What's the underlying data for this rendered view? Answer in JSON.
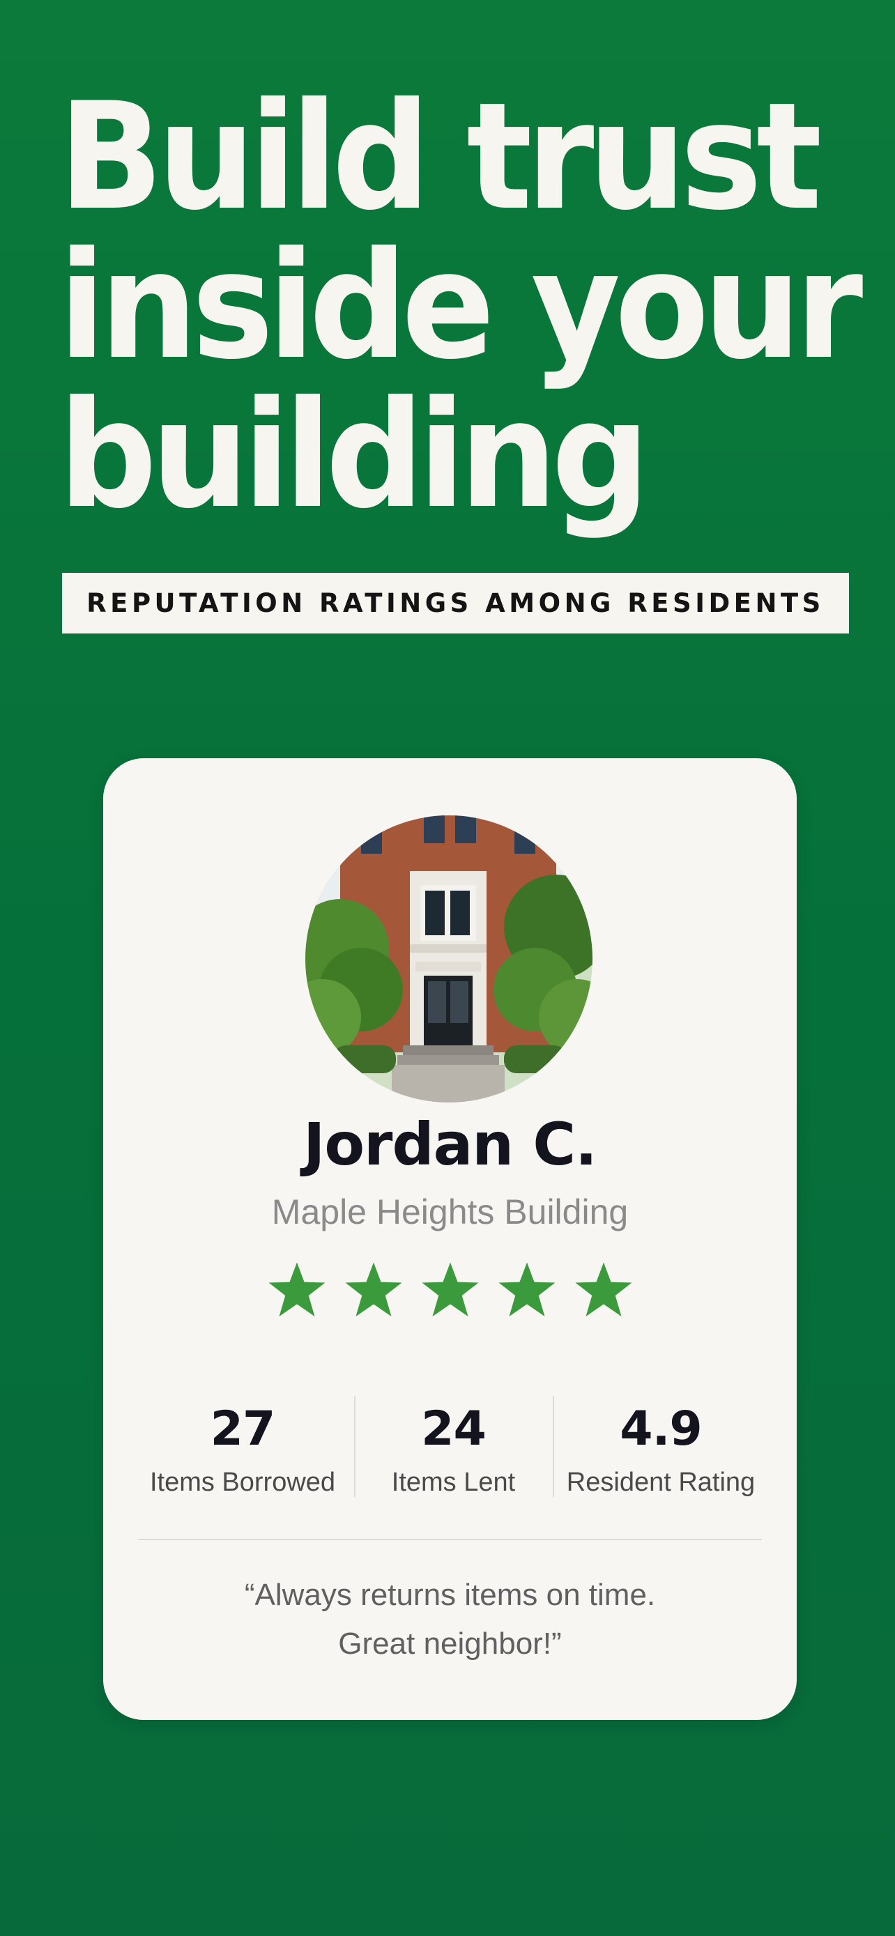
{
  "headline": {
    "line1": "Build trust",
    "line2": "inside your",
    "line3": "building"
  },
  "subtitle": "REPUTATION RATINGS AMONG RESIDENTS",
  "profile": {
    "name": "Jordan C.",
    "building": "Maple Heights Building",
    "avatar_icon": "building-photo",
    "star_rating": 5,
    "star_max": 5,
    "stats": [
      {
        "value": "27",
        "label": "Items Borrowed"
      },
      {
        "value": "24",
        "label": "Items Lent"
      },
      {
        "value": "4.9",
        "label": "Resident Rating"
      }
    ],
    "quote_line1": "“Always returns items on time.",
    "quote_line2": "Great neighbor!”"
  },
  "colors": {
    "background": "#0b7a3a",
    "card": "#f7f6f2",
    "star": "#3a9a3c",
    "headline_text": "#f7f5ef"
  }
}
